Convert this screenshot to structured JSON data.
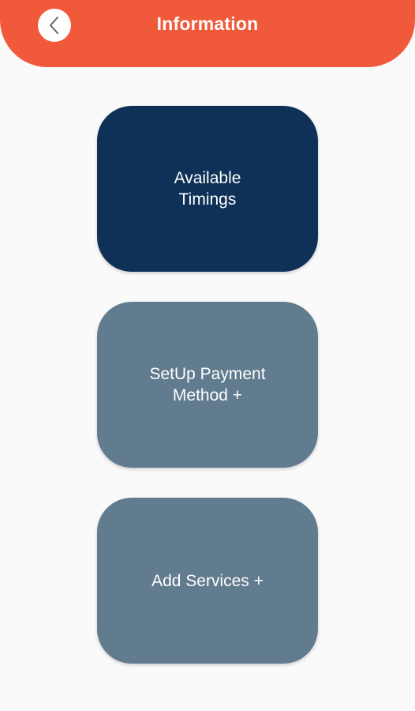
{
  "header": {
    "title": "Information",
    "back_icon": "chevron-left-icon"
  },
  "colors": {
    "header_bg": "#f05a3a",
    "page_bg": "#fafafa",
    "card_active_bg": "#0f3157",
    "card_inactive_bg": "#617b8f",
    "card_text": "#ffffff"
  },
  "cards": [
    {
      "label": "Available\nTimings"
    },
    {
      "label": "SetUp Payment\nMethod +"
    },
    {
      "label": "Add Services +"
    }
  ]
}
